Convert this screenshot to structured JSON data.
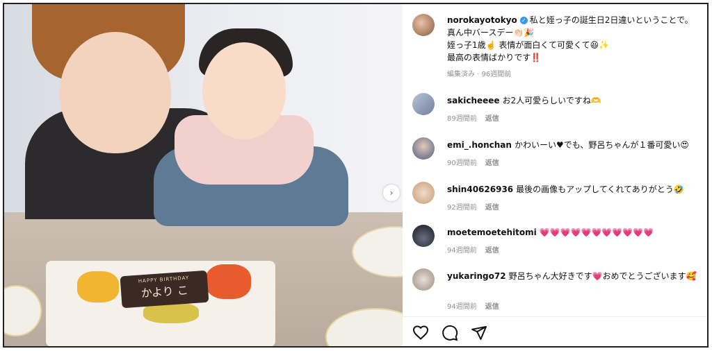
{
  "post": {
    "author": "norokayotokyo",
    "caption_line1": "私と姪っ子の誕生日2日違いということで。",
    "caption_line2": "真ん中バースデー👏🏻🎉",
    "caption_line3": "姪っ子1歳☝️ 表情が面白くて可愛くて😆✨",
    "caption_line4": "最高の表情ばかりです‼️",
    "meta": "編集済み · 96週間前"
  },
  "cake_plaque": {
    "line1": "HAPPY BIRTHDAY",
    "line2": "かより こ"
  },
  "comments": [
    {
      "user": "sakicheeee",
      "text": "お2人可愛らしいですね🫶",
      "time": "89週間前",
      "reply": "返信"
    },
    {
      "user": "emi_.honchan",
      "text": "かわいーい♥でも、野呂ちゃんが１番可愛い😍",
      "time": "90週間前",
      "reply": "返信"
    },
    {
      "user": "shin40626936",
      "text": "最後の画像もアップしてくれてありがとう🤣",
      "time": "92週間前",
      "reply": "返信"
    },
    {
      "user": "moetemoetehitomi",
      "text": "💗💗💗💗💗💗💗💗💗💗💗",
      "time": "94週間前",
      "reply": "返信"
    },
    {
      "user": "yukaringo72",
      "text": "野呂ちゃん大好きです💗おめでとうございます🥰",
      "time": "94週間前",
      "reply": "返信"
    }
  ],
  "icons": {
    "like": "heart-icon",
    "comment": "comment-icon",
    "share": "share-icon",
    "next": "chevron-right-icon",
    "verified": "verified-badge-icon"
  }
}
